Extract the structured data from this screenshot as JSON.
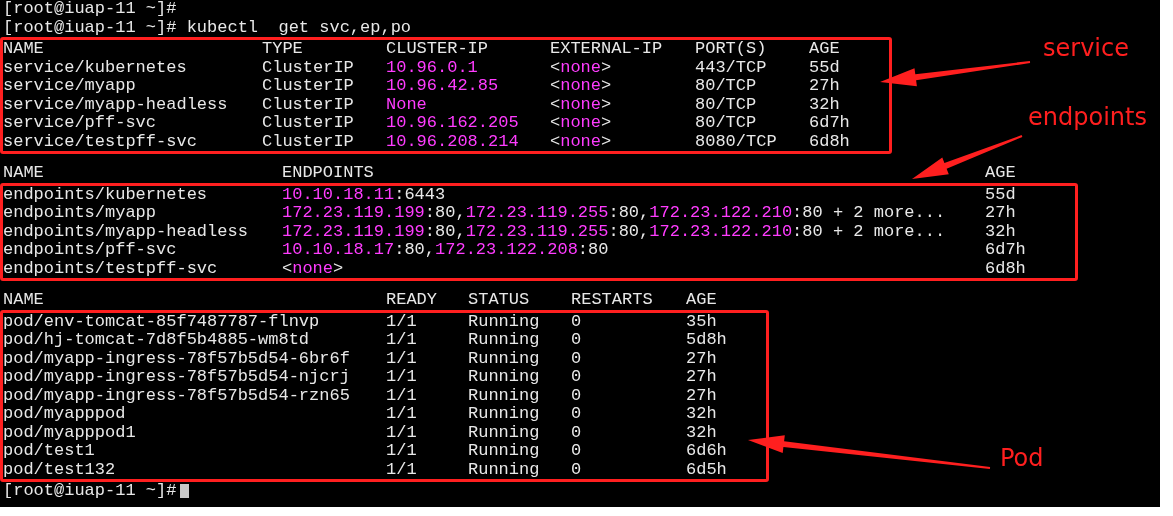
{
  "terminal": {
    "previous_prompt": "[root@iuap-11 ~]#",
    "command_line": {
      "prompt": "[root@iuap-11 ~]#",
      "command": "kubectl  get svc,ep,po"
    },
    "sections": [
      {
        "header_in_box": true,
        "columns": [
          "NAME",
          "TYPE",
          "CLUSTER-IP",
          "EXTERNAL-IP",
          "PORT(S)",
          "AGE"
        ],
        "rows": [
          [
            "service/kubernetes",
            "ClusterIP",
            [
              {
                "text": "10.96.0.1",
                "highlight": true
              }
            ],
            [
              {
                "text": "<",
                "highlight": false
              },
              {
                "text": "none",
                "highlight": true
              },
              {
                "text": ">",
                "highlight": false
              }
            ],
            "443/TCP",
            "55d"
          ],
          [
            "service/myapp",
            "ClusterIP",
            [
              {
                "text": "10.96.42.85",
                "highlight": true
              }
            ],
            [
              {
                "text": "<",
                "highlight": false
              },
              {
                "text": "none",
                "highlight": true
              },
              {
                "text": ">",
                "highlight": false
              }
            ],
            "80/TCP",
            "27h"
          ],
          [
            "service/myapp-headless",
            "ClusterIP",
            [
              {
                "text": "None",
                "highlight": true
              }
            ],
            [
              {
                "text": "<",
                "highlight": false
              },
              {
                "text": "none",
                "highlight": true
              },
              {
                "text": ">",
                "highlight": false
              }
            ],
            "80/TCP",
            "32h"
          ],
          [
            "service/pff-svc",
            "ClusterIP",
            [
              {
                "text": "10.96.162.205",
                "highlight": true
              }
            ],
            [
              {
                "text": "<",
                "highlight": false
              },
              {
                "text": "none",
                "highlight": true
              },
              {
                "text": ">",
                "highlight": false
              }
            ],
            "80/TCP",
            "6d7h"
          ],
          [
            "service/testpff-svc",
            "ClusterIP",
            [
              {
                "text": "10.96.208.214",
                "highlight": true
              }
            ],
            [
              {
                "text": "<",
                "highlight": false
              },
              {
                "text": "none",
                "highlight": true
              },
              {
                "text": ">",
                "highlight": false
              }
            ],
            "8080/TCP",
            "6d8h"
          ]
        ]
      },
      {
        "header_in_box": false,
        "columns": [
          "NAME",
          "ENDPOINTS",
          "AGE"
        ],
        "rows": [
          [
            "endpoints/kubernetes",
            [
              {
                "text": "10.10.18.11",
                "highlight": true
              },
              {
                "text": ":6443",
                "highlight": false
              }
            ],
            "55d"
          ],
          [
            "endpoints/myapp",
            [
              {
                "text": "172.23.119.199",
                "highlight": true
              },
              {
                "text": ":80,",
                "highlight": false
              },
              {
                "text": "172.23.119.255",
                "highlight": true
              },
              {
                "text": ":80,",
                "highlight": false
              },
              {
                "text": "172.23.122.210",
                "highlight": true
              },
              {
                "text": ":80 + 2 more...",
                "highlight": false
              }
            ],
            "27h"
          ],
          [
            "endpoints/myapp-headless",
            [
              {
                "text": "172.23.119.199",
                "highlight": true
              },
              {
                "text": ":80,",
                "highlight": false
              },
              {
                "text": "172.23.119.255",
                "highlight": true
              },
              {
                "text": ":80,",
                "highlight": false
              },
              {
                "text": "172.23.122.210",
                "highlight": true
              },
              {
                "text": ":80 + 2 more...",
                "highlight": false
              }
            ],
            "32h"
          ],
          [
            "endpoints/pff-svc",
            [
              {
                "text": "10.10.18.17",
                "highlight": true
              },
              {
                "text": ":80,",
                "highlight": false
              },
              {
                "text": "172.23.122.208",
                "highlight": true
              },
              {
                "text": ":80",
                "highlight": false
              }
            ],
            "6d7h"
          ],
          [
            "endpoints/testpff-svc",
            [
              {
                "text": "<",
                "highlight": false
              },
              {
                "text": "none",
                "highlight": true
              },
              {
                "text": ">",
                "highlight": false
              }
            ],
            "6d8h"
          ]
        ]
      },
      {
        "header_in_box": false,
        "columns": [
          "NAME",
          "READY",
          "STATUS",
          "RESTARTS",
          "AGE"
        ],
        "rows": [
          [
            "pod/env-tomcat-85f7487787-flnvp",
            "1/1",
            "Running",
            "0",
            "35h"
          ],
          [
            "pod/hj-tomcat-7d8f5b4885-wm8td",
            "1/1",
            "Running",
            "0",
            "5d8h"
          ],
          [
            "pod/myapp-ingress-78f57b5d54-6br6f",
            "1/1",
            "Running",
            "0",
            "27h"
          ],
          [
            "pod/myapp-ingress-78f57b5d54-njcrj",
            "1/1",
            "Running",
            "0",
            "27h"
          ],
          [
            "pod/myapp-ingress-78f57b5d54-rzn65",
            "1/1",
            "Running",
            "0",
            "27h"
          ],
          [
            "pod/myapppod",
            "1/1",
            "Running",
            "0",
            "32h"
          ],
          [
            "pod/myapppod1",
            "1/1",
            "Running",
            "0",
            "32h"
          ],
          [
            "pod/test1",
            "1/1",
            "Running",
            "0",
            "6d6h"
          ],
          [
            "pod/test132",
            "1/1",
            "Running",
            "0",
            "6d5h"
          ]
        ]
      }
    ],
    "final_prompt": "[root@iuap-11 ~]#"
  },
  "annotations": [
    {
      "label": "service"
    },
    {
      "label": "endpoints"
    },
    {
      "label": "Pod"
    }
  ]
}
